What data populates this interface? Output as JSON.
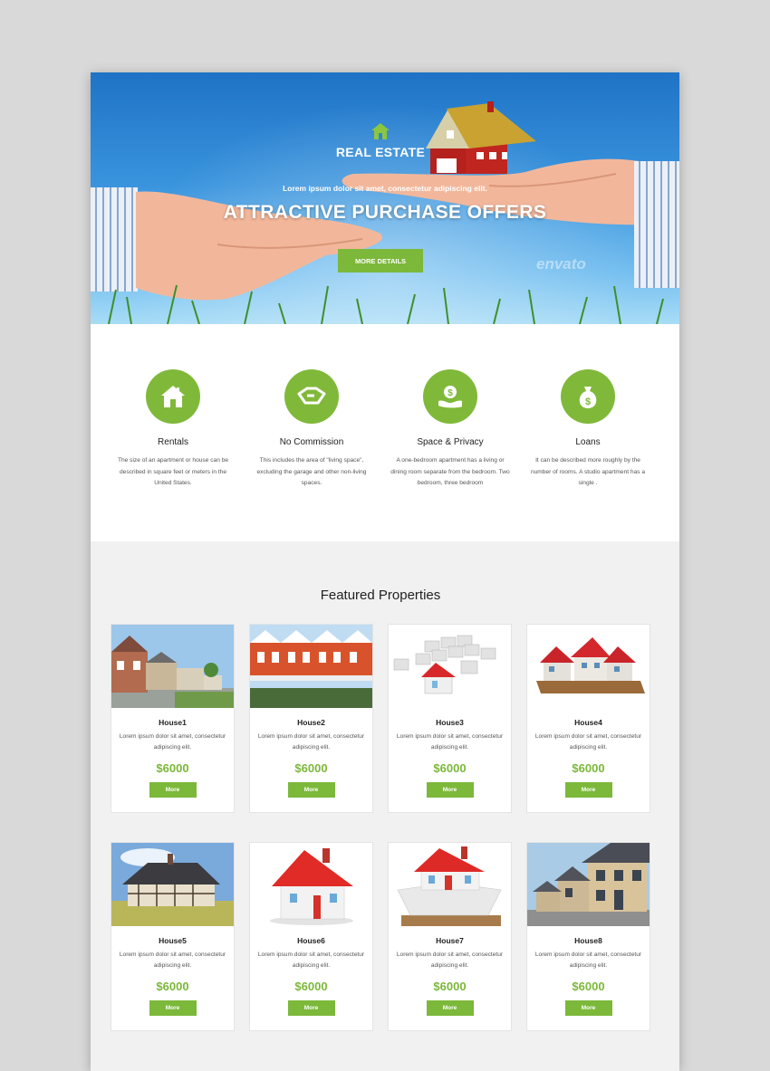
{
  "hero": {
    "brand": "REAL ESTATE",
    "tagline": "Lorem ipsum dolor sit amet, consectetur adipiscing elit.",
    "headline": "ATTRACTIVE PURCHASE OFFERS",
    "cta_label": "MORE DETAILS",
    "watermark": "envato"
  },
  "features": [
    {
      "icon": "house-icon",
      "title": "Rentals",
      "desc": "The size of an apartment or house can be described in square feet or meters in the United States."
    },
    {
      "icon": "handshake-icon",
      "title": "No Commission",
      "desc": "This includes the area of \"living space\", excluding the garage and other non-living spaces."
    },
    {
      "icon": "money-hand-icon",
      "title": "Space & Privacy",
      "desc": "A one-bedroom apartment has a living or dining room separate from the bedroom. Two bedroom, three bedroom"
    },
    {
      "icon": "money-bag-icon",
      "title": "Loans",
      "desc": "It can be described more roughly by the number of rooms. A studio apartment has a single ."
    }
  ],
  "properties": {
    "heading": "Featured Properties",
    "items": [
      {
        "name": "House1",
        "desc": "Lorem ipsum dolor sit amet, consectetur adipiscing elit.",
        "price": "$6000",
        "button": "More"
      },
      {
        "name": "House2",
        "desc": "Lorem ipsum dolor sit amet, consectetur adipiscing elit.",
        "price": "$6000",
        "button": "More"
      },
      {
        "name": "House3",
        "desc": "Lorem ipsum dolor sit amet, consectetur adipiscing elit.",
        "price": "$6000",
        "button": "More"
      },
      {
        "name": "House4",
        "desc": "Lorem ipsum dolor sit amet, consectetur adipiscing elit.",
        "price": "$6000",
        "button": "More"
      },
      {
        "name": "House5",
        "desc": "Lorem ipsum dolor sit amet, consectetur adipiscing elit.",
        "price": "$6000",
        "button": "More"
      },
      {
        "name": "House6",
        "desc": "Lorem ipsum dolor sit amet, consectetur adipiscing elit.",
        "price": "$6000",
        "button": "More"
      },
      {
        "name": "House7",
        "desc": "Lorem ipsum dolor sit amet, consectetur adipiscing elit.",
        "price": "$6000",
        "button": "More"
      },
      {
        "name": "House8",
        "desc": "Lorem ipsum dolor sit amet, consectetur adipiscing elit.",
        "price": "$6000",
        "button": "More"
      }
    ]
  },
  "colors": {
    "accent": "#7cb83a",
    "hero_sky": "#2f86d4",
    "section_bg": "#f1f1f1"
  }
}
